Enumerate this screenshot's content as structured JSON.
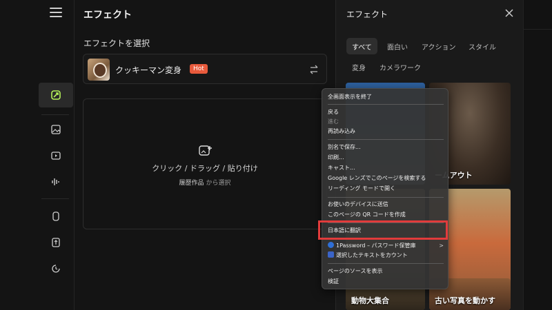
{
  "rail": {
    "items": [
      {
        "name": "effects",
        "icon": "sparkle-badge-icon",
        "active": true
      },
      {
        "name": "image",
        "icon": "image-icon"
      },
      {
        "name": "video",
        "icon": "video-frame-icon"
      },
      {
        "name": "audio",
        "icon": "waveform-icon"
      },
      {
        "name": "model",
        "icon": "cube-icon"
      },
      {
        "name": "upload",
        "icon": "upload-icon"
      },
      {
        "name": "history",
        "icon": "history-icon"
      }
    ]
  },
  "main": {
    "title": "エフェクト",
    "select_label": "エフェクトを選択",
    "selected_effect": {
      "name": "クッキーマン変身",
      "badge": "Hot"
    },
    "upload": {
      "main_text": "クリック / ドラッグ / 貼り付け",
      "history_link": "履歴作品",
      "suffix": "から選択"
    }
  },
  "panel": {
    "title": "エフェクト",
    "tabs": [
      "すべて",
      "面白い",
      "アクション",
      "スタイル",
      "変身",
      "カメラワーク"
    ],
    "active_tab": "すべて",
    "tiles": [
      {
        "label": ""
      },
      {
        "label": "ームアウト"
      },
      {
        "label": ""
      },
      {
        "label": ""
      },
      {
        "label": "動物大集合"
      },
      {
        "label": "古い写真を動かす"
      }
    ]
  },
  "context_menu": {
    "items": [
      {
        "label": "全画面表示を終了"
      },
      {
        "label": "戻る"
      },
      {
        "label": "進む",
        "disabled": true
      },
      {
        "label": "再読み込み"
      },
      {
        "label": "別名で保存..."
      },
      {
        "label": "印刷..."
      },
      {
        "label": "キャスト..."
      },
      {
        "label": "Google レンズでこのページを検索する"
      },
      {
        "label": "リーディング モードで開く"
      },
      {
        "label": "お使いのデバイスに送信"
      },
      {
        "label": "このページの QR コードを作成"
      },
      {
        "label": "日本語に翻訳"
      },
      {
        "label": "1Password – パスワード保管庫",
        "submenu_arrow": ">"
      },
      {
        "label": "選択したテキストをカウント"
      },
      {
        "label": "ページのソースを表示"
      },
      {
        "label": "検証"
      }
    ]
  },
  "colors": {
    "hot_badge": "#e85a3c",
    "highlight": "#e23b3b",
    "accent_green": "#b6f35a"
  }
}
